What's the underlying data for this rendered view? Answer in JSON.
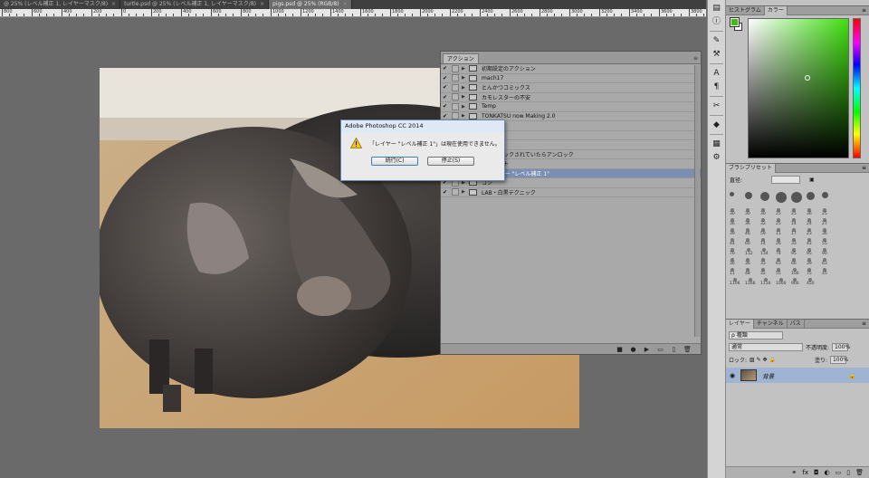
{
  "tabs": [
    {
      "label": "@ 25% (レベル補正 1, レイヤーマスク/8)",
      "active": false
    },
    {
      "label": "turtle.psd @ 25% (レベル補正 1, レイヤーマスク/8)",
      "active": false
    },
    {
      "label": "pigs.psd @ 25% (RGB/8)",
      "active": true
    }
  ],
  "ruler": {
    "labels": [
      "800",
      "600",
      "400",
      "200",
      "0",
      "200",
      "400",
      "600",
      "800",
      "1000",
      "1200",
      "1400",
      "1600",
      "1800",
      "2000",
      "2200",
      "2400",
      "2600",
      "2800",
      "3000",
      "3200",
      "3400",
      "3600",
      "3800"
    ]
  },
  "actions_panel": {
    "tab": "アクション",
    "items": [
      {
        "label": "初期設定のアクション",
        "checked": true,
        "selected": false
      },
      {
        "label": "mach17",
        "checked": true,
        "selected": false
      },
      {
        "label": "とんかつコミックス",
        "checked": true,
        "selected": false
      },
      {
        "label": "カモレスターの不安",
        "checked": true,
        "selected": false
      },
      {
        "label": "Temp",
        "checked": true,
        "selected": false
      },
      {
        "label": "TONKATSU now Making 2.0",
        "checked": true,
        "selected": false
      },
      {
        "label": "写真処理",
        "checked": true,
        "selected": false
      },
      {
        "label": "スト",
        "checked": true,
        "selected": false
      },
      {
        "label": "",
        "checked": true,
        "selected": false
      },
      {
        "label": "ヤーがロックされていたらアンロック",
        "checked": true,
        "selected": false
      },
      {
        "label": "ードライト",
        "checked": true,
        "selected": false
      },
      {
        "label": "是 レイヤー \"レベル補正 1\"",
        "checked": true,
        "selected": true
      },
      {
        "label": "コン",
        "checked": true,
        "selected": false
      },
      {
        "label": "LAB・白黒テクニック",
        "checked": true,
        "selected": false
      }
    ]
  },
  "dialog": {
    "title": "Adobe Photoshop CC 2014",
    "message": "「レイヤー \"レベル補正 1\"」は現在使用できません。",
    "continue_label": "続行(C)",
    "stop_label": "停止(S)"
  },
  "color_panel": {
    "tabs": [
      "ヒストグラム",
      "カラー"
    ],
    "fg_color": "#3cc00b",
    "bg_color": "#ffffff"
  },
  "brush_panel": {
    "tab": "ブラシプリセット",
    "size_label": "直径:",
    "numbers": [
      "30",
      "30",
      "30",
      "25",
      "25",
      "36",
      "25",
      "36",
      "36",
      "32",
      "25",
      "14",
      "24",
      "27",
      "39",
      "46",
      "59",
      "11",
      "17",
      "23",
      "36",
      "44",
      "60",
      "14",
      "26",
      "33",
      "42",
      "55",
      "70",
      "112",
      "134",
      "74",
      "95",
      "95",
      "90",
      "36",
      "36",
      "33",
      "63",
      "66",
      "39",
      "63",
      "11",
      "48",
      "32",
      "55",
      "100",
      "75",
      "45",
      "1106",
      "1166",
      "1116",
      "1000",
      "900",
      "450"
    ]
  },
  "layers_panel": {
    "tabs": [
      "レイヤー",
      "チャンネル",
      "パス"
    ],
    "filter_label": "種類",
    "blend_mode": "通常",
    "opacity_label": "不透明度:",
    "opacity_value": "100%",
    "lock_label": "ロック:",
    "fill_label": "塗り:",
    "fill_value": "100%",
    "layer_name": "背景"
  },
  "colors": {
    "accent_selected": "#7a8eb4",
    "dialog_border": "#6a86b3"
  }
}
